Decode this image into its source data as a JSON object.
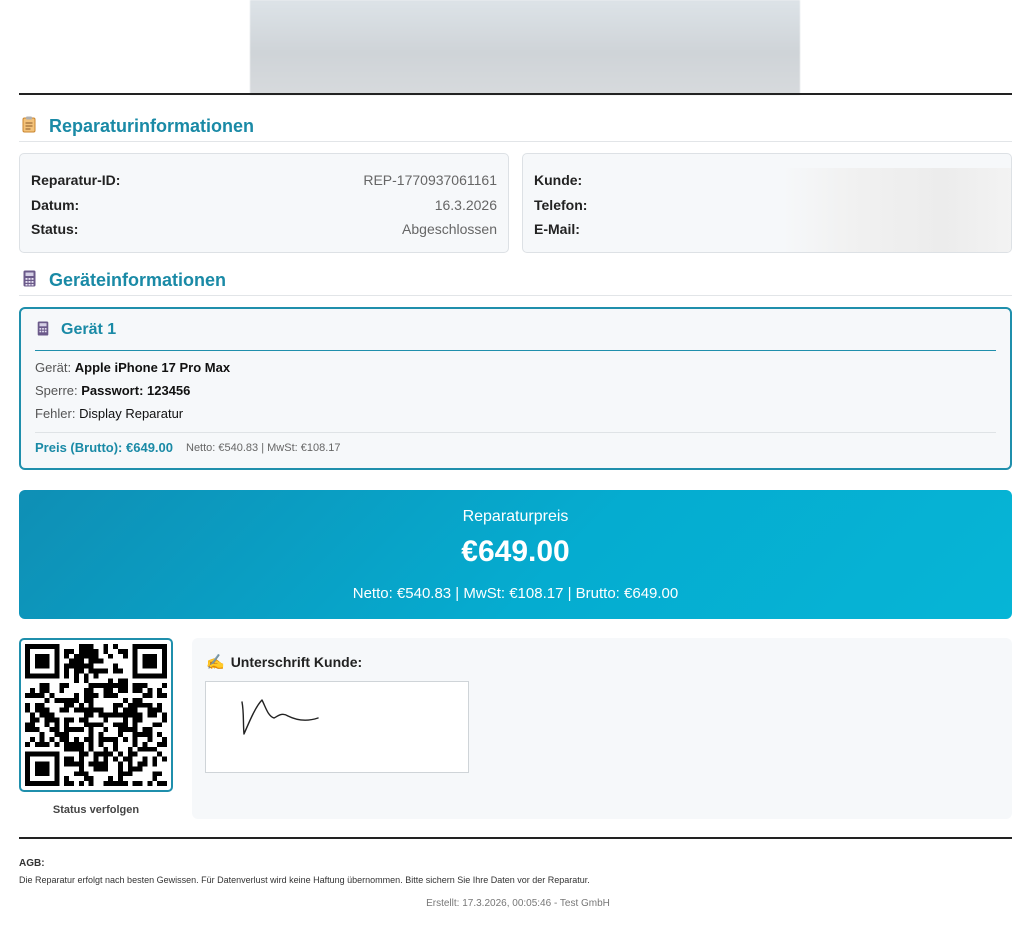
{
  "header": {
    "logo_blurred": true
  },
  "sections": {
    "repair_info": {
      "icon": "clipboard-icon",
      "title": "Reparaturinformationen"
    },
    "device_info": {
      "icon": "calculator-icon",
      "title": "Geräteinformationen"
    }
  },
  "repair": {
    "rows": [
      {
        "label": "Reparatur-ID:",
        "value": "REP-1770937061161"
      },
      {
        "label": "Datum:",
        "value": "16.3.2026"
      },
      {
        "label": "Status:",
        "value": "Abgeschlossen"
      }
    ]
  },
  "customer": {
    "rows": [
      {
        "label": "Kunde:",
        "value": ""
      },
      {
        "label": "Telefon:",
        "value": ""
      },
      {
        "label": "E-Mail:",
        "value": ""
      }
    ],
    "values_redacted": true
  },
  "device": {
    "icon": "calculator-icon",
    "title": "Gerät 1",
    "device_label": "Gerät:",
    "device_value": "Apple iPhone 17 Pro Max",
    "lock_label": "Sperre:",
    "lock_value": "Passwort: 123456",
    "fault_label": "Fehler:",
    "fault_value": "Display Reparatur",
    "price_gross": "Preis (Brutto): €649.00",
    "price_net": "Netto: €540.83 | MwSt: €108.17"
  },
  "price_banner": {
    "label": "Reparaturpreis",
    "amount": "€649.00",
    "breakdown": "Netto: €540.83 | MwSt: €108.17 | Brutto: €649.00"
  },
  "qr": {
    "caption": "Status verfolgen"
  },
  "signature": {
    "icon": "writing-hand-icon",
    "title": "Unterschrift Kunde:"
  },
  "footer": {
    "agb_title": "AGB:",
    "agb_text": "Die Reparatur erfolgt nach besten Gewissen. Für Datenverlust wird keine Haftung übernommen. Bitte sichern Sie Ihre Daten vor der Reparatur.",
    "created": "Erstellt: 17.3.2026, 00:05:46 - Test GmbH"
  },
  "colors": {
    "accent": "#1a8aa6",
    "banner_start": "#0f8fb5",
    "banner_end": "#06b5d6"
  }
}
